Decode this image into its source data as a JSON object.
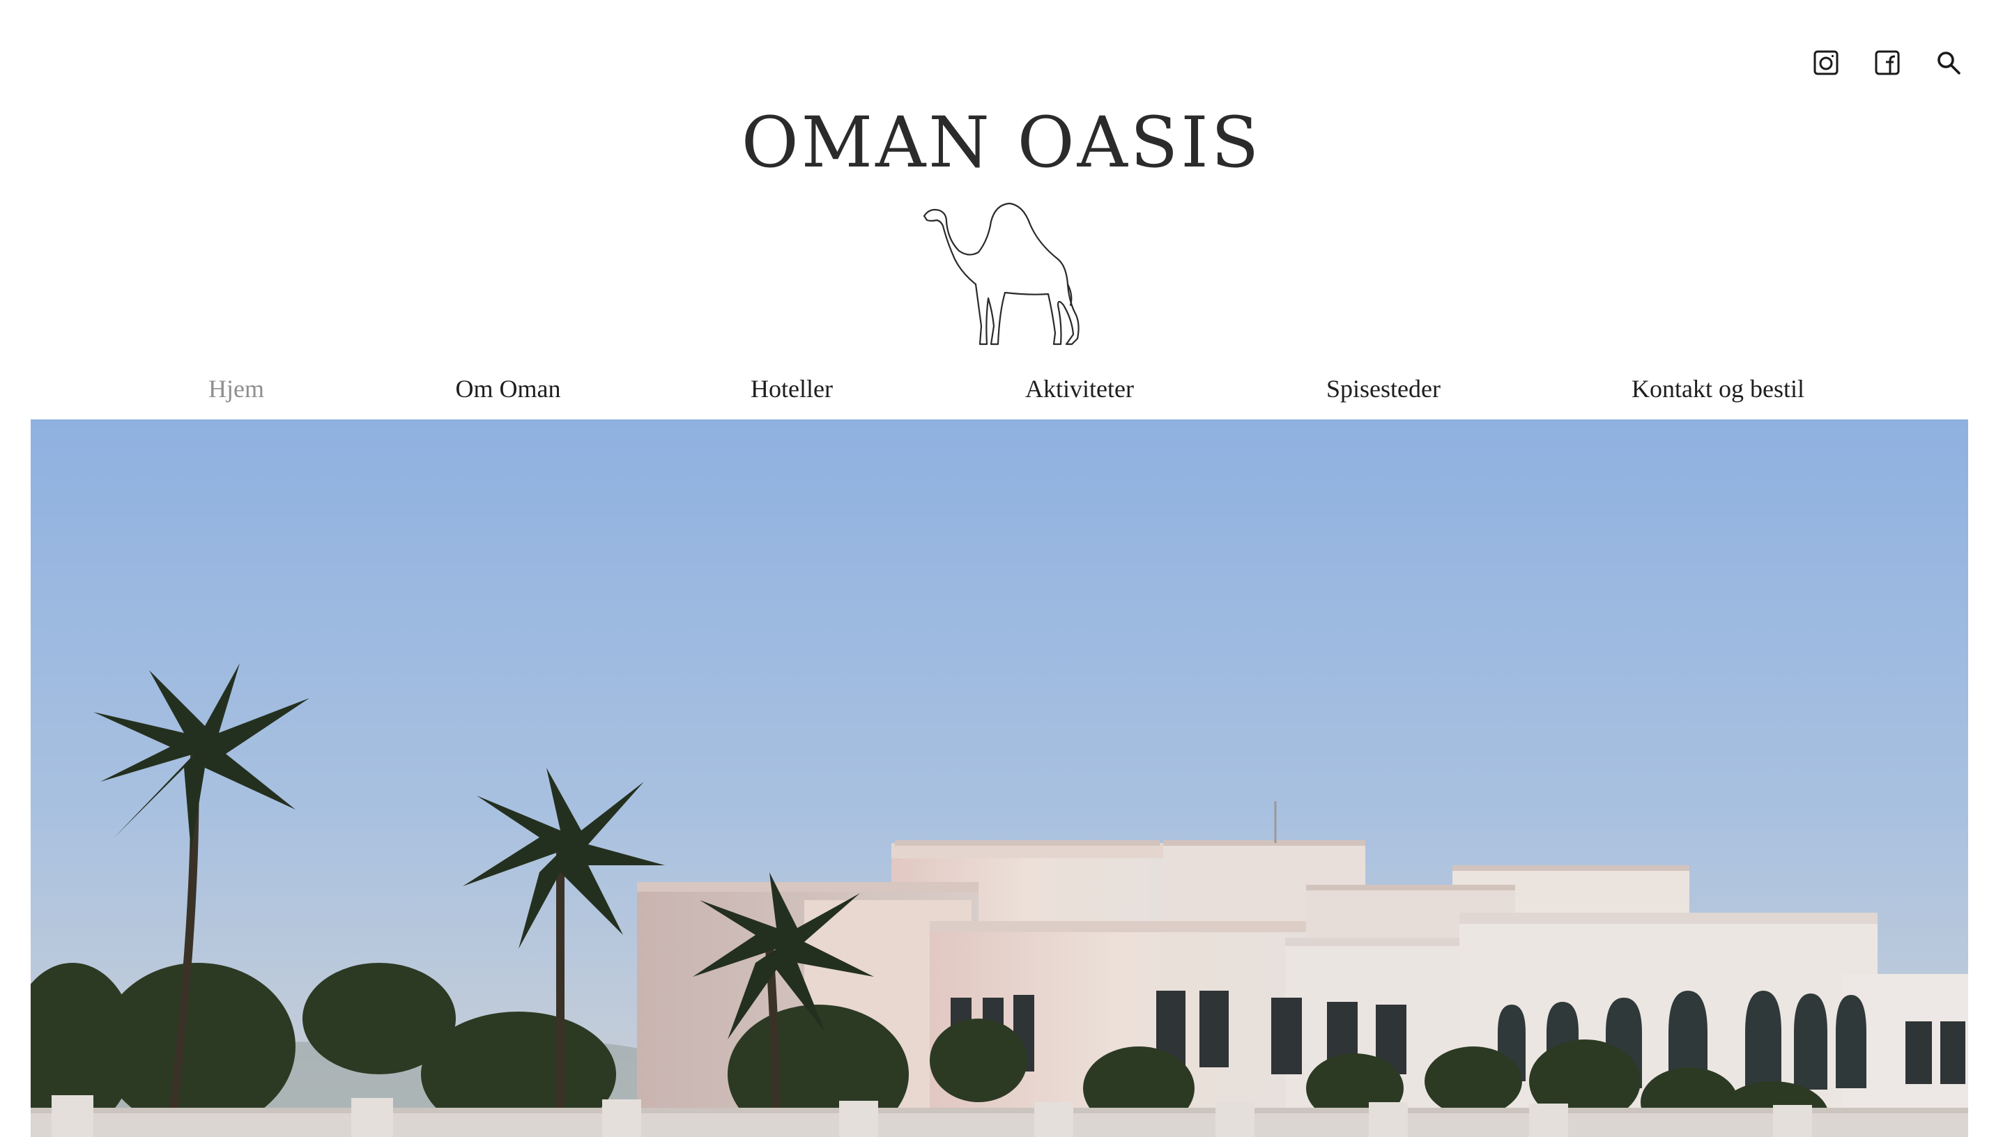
{
  "header": {
    "title": "OMAN OASIS",
    "icons": [
      "instagram-icon",
      "facebook-icon",
      "search-icon"
    ]
  },
  "nav": {
    "items": [
      {
        "label": "Hjem",
        "active": true
      },
      {
        "label": "Om Oman",
        "active": false
      },
      {
        "label": "Hoteller",
        "active": false
      },
      {
        "label": "Aktiviteter",
        "active": false
      },
      {
        "label": "Spisesteder",
        "active": false
      },
      {
        "label": "Kontakt og bestil",
        "active": false
      }
    ]
  },
  "colors": {
    "title": "#2b2b2b",
    "nav_text": "#1e1e1e",
    "nav_active": "#8f8f8f",
    "sky_top": "#8fb2df",
    "sky_bottom": "#c6cfd8",
    "building": "#e9dcd4"
  }
}
